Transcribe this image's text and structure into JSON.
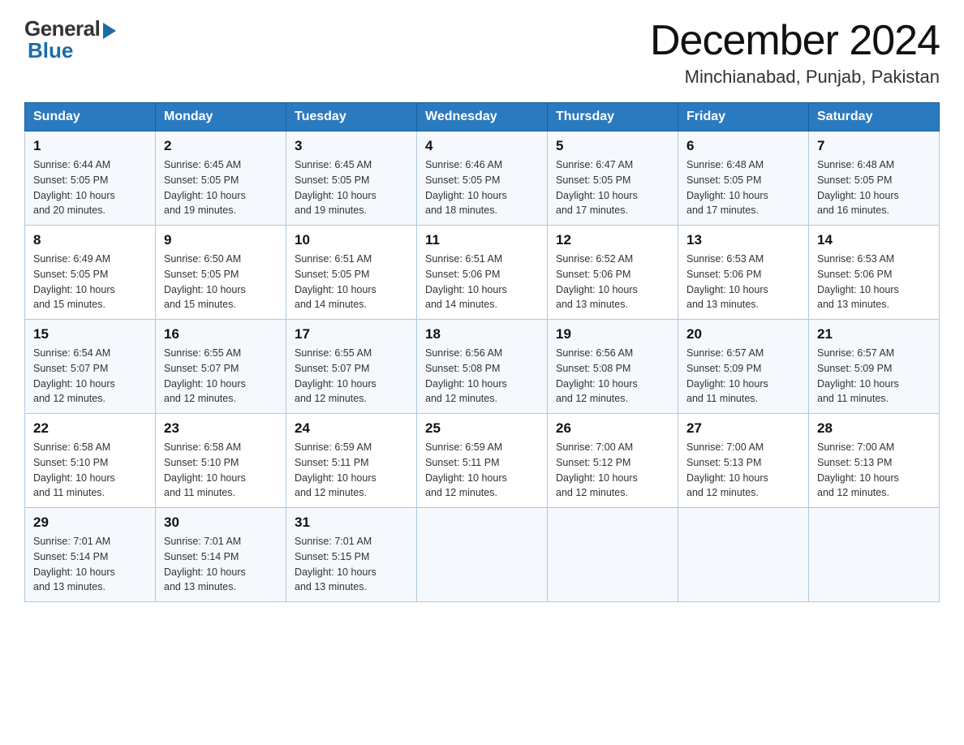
{
  "header": {
    "logo_general": "General",
    "logo_blue": "Blue",
    "title": "December 2024",
    "subtitle": "Minchianabad, Punjab, Pakistan"
  },
  "weekdays": [
    "Sunday",
    "Monday",
    "Tuesday",
    "Wednesday",
    "Thursday",
    "Friday",
    "Saturday"
  ],
  "weeks": [
    [
      {
        "day": "1",
        "sunrise": "6:44 AM",
        "sunset": "5:05 PM",
        "daylight": "10 hours and 20 minutes."
      },
      {
        "day": "2",
        "sunrise": "6:45 AM",
        "sunset": "5:05 PM",
        "daylight": "10 hours and 19 minutes."
      },
      {
        "day": "3",
        "sunrise": "6:45 AM",
        "sunset": "5:05 PM",
        "daylight": "10 hours and 19 minutes."
      },
      {
        "day": "4",
        "sunrise": "6:46 AM",
        "sunset": "5:05 PM",
        "daylight": "10 hours and 18 minutes."
      },
      {
        "day": "5",
        "sunrise": "6:47 AM",
        "sunset": "5:05 PM",
        "daylight": "10 hours and 17 minutes."
      },
      {
        "day": "6",
        "sunrise": "6:48 AM",
        "sunset": "5:05 PM",
        "daylight": "10 hours and 17 minutes."
      },
      {
        "day": "7",
        "sunrise": "6:48 AM",
        "sunset": "5:05 PM",
        "daylight": "10 hours and 16 minutes."
      }
    ],
    [
      {
        "day": "8",
        "sunrise": "6:49 AM",
        "sunset": "5:05 PM",
        "daylight": "10 hours and 15 minutes."
      },
      {
        "day": "9",
        "sunrise": "6:50 AM",
        "sunset": "5:05 PM",
        "daylight": "10 hours and 15 minutes."
      },
      {
        "day": "10",
        "sunrise": "6:51 AM",
        "sunset": "5:05 PM",
        "daylight": "10 hours and 14 minutes."
      },
      {
        "day": "11",
        "sunrise": "6:51 AM",
        "sunset": "5:06 PM",
        "daylight": "10 hours and 14 minutes."
      },
      {
        "day": "12",
        "sunrise": "6:52 AM",
        "sunset": "5:06 PM",
        "daylight": "10 hours and 13 minutes."
      },
      {
        "day": "13",
        "sunrise": "6:53 AM",
        "sunset": "5:06 PM",
        "daylight": "10 hours and 13 minutes."
      },
      {
        "day": "14",
        "sunrise": "6:53 AM",
        "sunset": "5:06 PM",
        "daylight": "10 hours and 13 minutes."
      }
    ],
    [
      {
        "day": "15",
        "sunrise": "6:54 AM",
        "sunset": "5:07 PM",
        "daylight": "10 hours and 12 minutes."
      },
      {
        "day": "16",
        "sunrise": "6:55 AM",
        "sunset": "5:07 PM",
        "daylight": "10 hours and 12 minutes."
      },
      {
        "day": "17",
        "sunrise": "6:55 AM",
        "sunset": "5:07 PM",
        "daylight": "10 hours and 12 minutes."
      },
      {
        "day": "18",
        "sunrise": "6:56 AM",
        "sunset": "5:08 PM",
        "daylight": "10 hours and 12 minutes."
      },
      {
        "day": "19",
        "sunrise": "6:56 AM",
        "sunset": "5:08 PM",
        "daylight": "10 hours and 12 minutes."
      },
      {
        "day": "20",
        "sunrise": "6:57 AM",
        "sunset": "5:09 PM",
        "daylight": "10 hours and 11 minutes."
      },
      {
        "day": "21",
        "sunrise": "6:57 AM",
        "sunset": "5:09 PM",
        "daylight": "10 hours and 11 minutes."
      }
    ],
    [
      {
        "day": "22",
        "sunrise": "6:58 AM",
        "sunset": "5:10 PM",
        "daylight": "10 hours and 11 minutes."
      },
      {
        "day": "23",
        "sunrise": "6:58 AM",
        "sunset": "5:10 PM",
        "daylight": "10 hours and 11 minutes."
      },
      {
        "day": "24",
        "sunrise": "6:59 AM",
        "sunset": "5:11 PM",
        "daylight": "10 hours and 12 minutes."
      },
      {
        "day": "25",
        "sunrise": "6:59 AM",
        "sunset": "5:11 PM",
        "daylight": "10 hours and 12 minutes."
      },
      {
        "day": "26",
        "sunrise": "7:00 AM",
        "sunset": "5:12 PM",
        "daylight": "10 hours and 12 minutes."
      },
      {
        "day": "27",
        "sunrise": "7:00 AM",
        "sunset": "5:13 PM",
        "daylight": "10 hours and 12 minutes."
      },
      {
        "day": "28",
        "sunrise": "7:00 AM",
        "sunset": "5:13 PM",
        "daylight": "10 hours and 12 minutes."
      }
    ],
    [
      {
        "day": "29",
        "sunrise": "7:01 AM",
        "sunset": "5:14 PM",
        "daylight": "10 hours and 13 minutes."
      },
      {
        "day": "30",
        "sunrise": "7:01 AM",
        "sunset": "5:14 PM",
        "daylight": "10 hours and 13 minutes."
      },
      {
        "day": "31",
        "sunrise": "7:01 AM",
        "sunset": "5:15 PM",
        "daylight": "10 hours and 13 minutes."
      },
      null,
      null,
      null,
      null
    ]
  ],
  "labels": {
    "sunrise": "Sunrise:",
    "sunset": "Sunset:",
    "daylight": "Daylight:"
  }
}
